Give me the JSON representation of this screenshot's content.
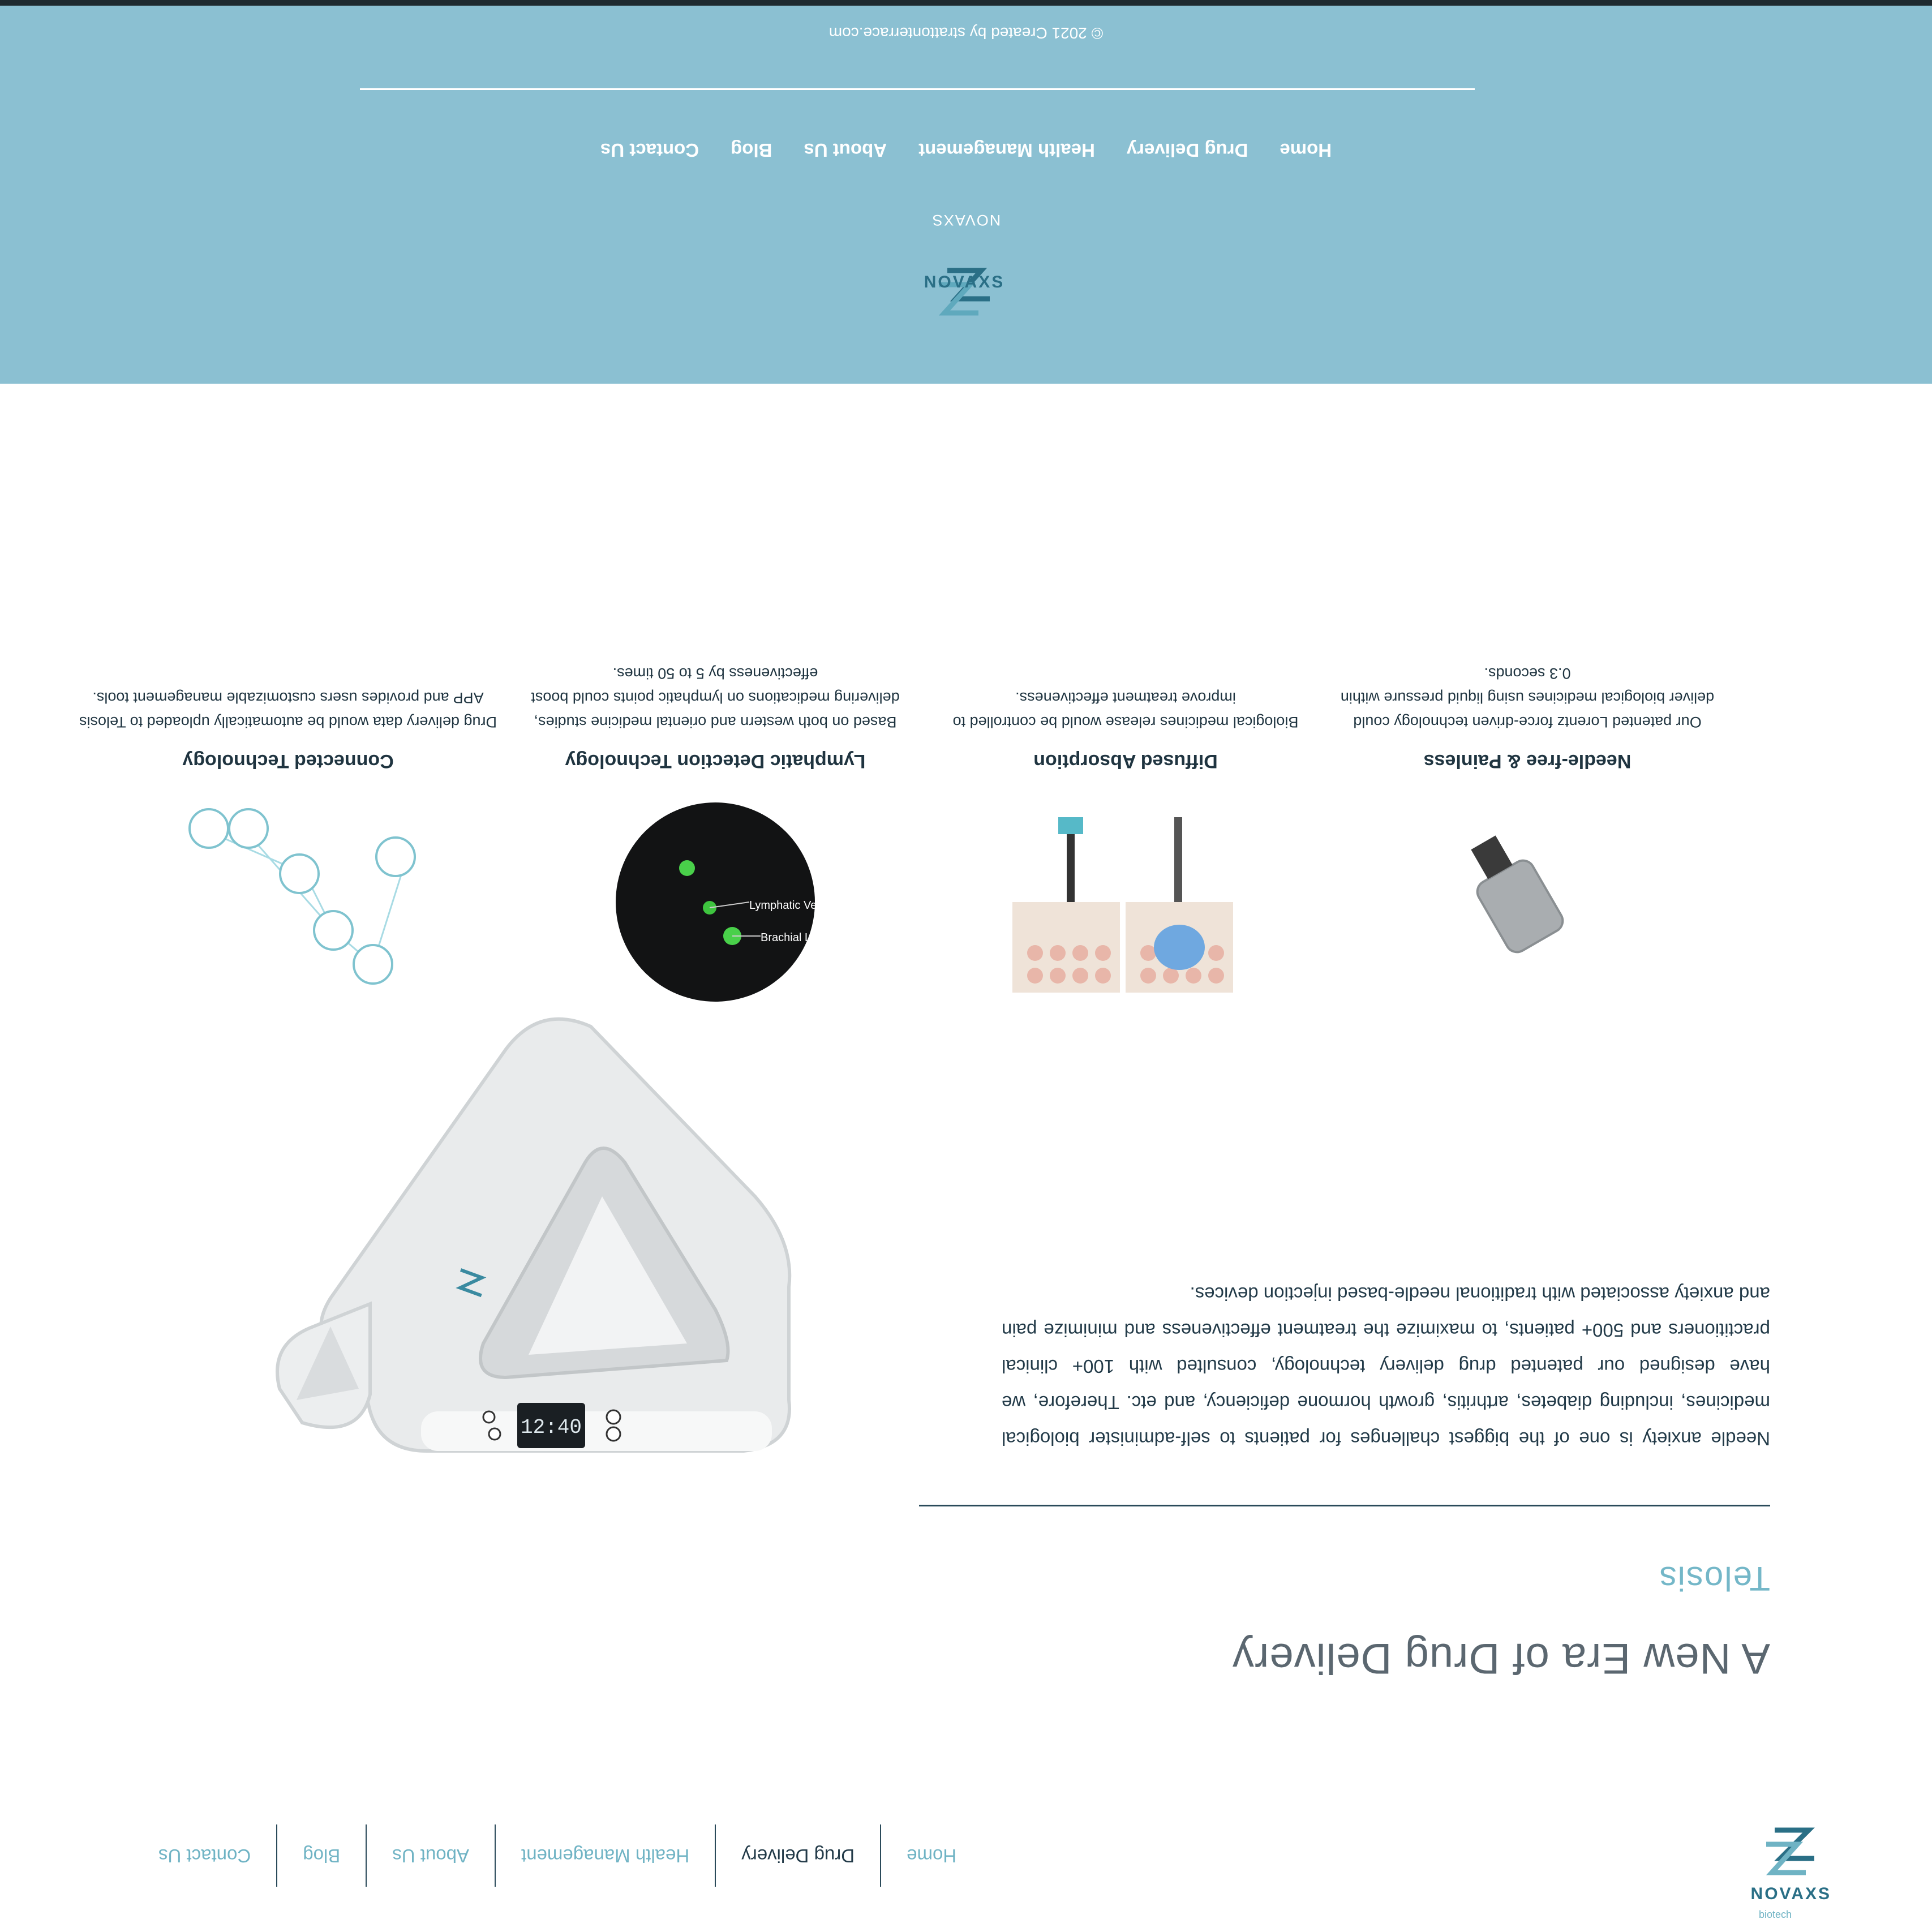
{
  "brand": {
    "name": "NOVAXS",
    "tagline": "biotech"
  },
  "nav": {
    "items": [
      {
        "label": "Home"
      },
      {
        "label": "Drug Delivery"
      },
      {
        "label": "Health Management"
      },
      {
        "label": "About Us"
      },
      {
        "label": "Blog"
      },
      {
        "label": "Contact Us"
      }
    ]
  },
  "hero": {
    "title": "A New Era of Drug Delivery",
    "subtitle": "Telosis",
    "body": "Needle anxiety is one of the biggest challenges for patients to self-administer biological medicines, including diabetes, arthritis, growth hormone deficiency, and etc. Therefore, we have designed our patented drug delivery technology, consulted with 100+ clinical practitioners and 500+ patients, to maximize the treatment effectiveness and minimize pain and anxiety associated with traditional needle-based injection devices.",
    "device_screen": "12:40"
  },
  "features": [
    {
      "title": "Needle-free & Painless",
      "desc": "Our patented Lorentz force-driven technology could deliver biological medicines using liquid pressure within 0.3 seconds."
    },
    {
      "title": "Diffused Absorption",
      "desc": "Biological medicines release would be controlled to improve treatment effectiveness."
    },
    {
      "title": "Lymphatic Detection Technology",
      "desc": "Based on both western and oriental medicine studies, delivering medications on lymphatic points could boost effectiveness by 5 to 50 times.",
      "labels": [
        "Brachial LN",
        "Lymphatic Vessels"
      ]
    },
    {
      "title": "Connected Technology",
      "desc": "Drug delivery data would be automatically uploaded to Telosis APP and provides users customizable management tools."
    }
  ],
  "footer": {
    "brand": "NOVAXS",
    "nav": [
      "Home",
      "Drug Delivery",
      "Health Management",
      "About Us",
      "Blog",
      "Contact Us"
    ],
    "copyright": "© 2021 Created by strattonterrace.com"
  },
  "colors": {
    "accent": "#74b7c8",
    "dark": "#223a48",
    "footer_bg": "#8bc0d2"
  }
}
